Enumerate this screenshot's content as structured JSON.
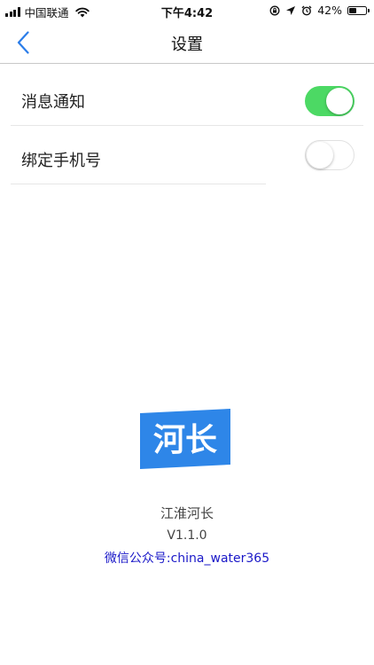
{
  "status_bar": {
    "carrier": "中国联通",
    "time": "下午4:42",
    "battery_percent": "42%",
    "battery_level": 0.42,
    "icons": [
      "signal-icon",
      "wifi-icon",
      "orientation-lock-icon",
      "location-icon",
      "alarm-icon",
      "battery-icon"
    ]
  },
  "nav": {
    "title": "设置",
    "back_icon": "chevron-left-icon"
  },
  "settings": {
    "items": [
      {
        "label": "消息通知",
        "toggle": "on"
      },
      {
        "label": "绑定手机号",
        "toggle": "off"
      }
    ]
  },
  "app_info": {
    "logo_text": "河长",
    "name": "江淮河长",
    "version": "V1.1.0",
    "wechat": "微信公众号:china_water365"
  },
  "colors": {
    "accent": "#2b7de9",
    "toggle_on": "#4cd964",
    "logo_bg": "#2e86e8",
    "link": "#1a18c8"
  }
}
